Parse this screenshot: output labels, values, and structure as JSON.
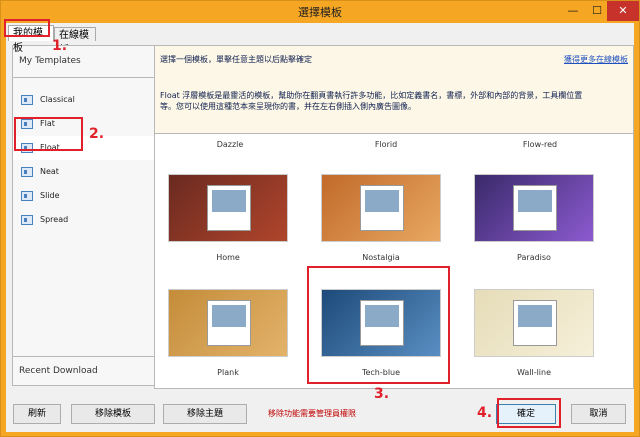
{
  "window": {
    "title": "選擇模板",
    "min": "—",
    "max": "☐",
    "close": "✕"
  },
  "tabs": [
    "我的模板",
    "在線模板"
  ],
  "left": {
    "header": "My Templates",
    "items": [
      "Classical",
      "Flat",
      "Float",
      "Neat",
      "Slide",
      "Spread"
    ],
    "selected": "Float",
    "recent": "Recent Download"
  },
  "info": {
    "line1": "選擇一個模板，單擊任意主題以后點擊確定",
    "more": "獲得更多在線模板",
    "desc": "Float 浮層模板是最靈活的模板，幫助你在翻頁書執行許多功能，比如定義書名，書標，外部和內部的背景，工具欄位置等。您可以使用這種范本來呈現你的書，并在左右側插入側內廣告圖像。"
  },
  "gallery": {
    "top": [
      "Dazzle",
      "Florid",
      "Flow-red"
    ],
    "themes": [
      {
        "name": "Home",
        "color": "#6a2a20",
        "color2": "#b0452c"
      },
      {
        "name": "Nostalgia",
        "color": "#c26a2a",
        "color2": "#e8a862"
      },
      {
        "name": "Paradiso",
        "color": "#3a2a6a",
        "color2": "#8c5ad0"
      },
      {
        "name": "Plank",
        "color": "#c48c3a",
        "color2": "#e3b36a"
      },
      {
        "name": "Tech-blue",
        "color": "#1d4a7a",
        "color2": "#5a8ec2"
      },
      {
        "name": "Wall-line",
        "color": "#e6dcb8",
        "color2": "#f6f0da"
      }
    ],
    "selected": "Tech-blue"
  },
  "buttons": {
    "refresh": "刷新",
    "remove_template": "移除模板",
    "remove_theme": "移除主題",
    "warn": "移除功能需要管理員權限",
    "ok": "確定",
    "cancel": "取消"
  },
  "steps": [
    "1.",
    "2.",
    "3.",
    "4."
  ],
  "colors": {
    "titlebar": "#f5a623",
    "highlight": "#e0202a"
  }
}
